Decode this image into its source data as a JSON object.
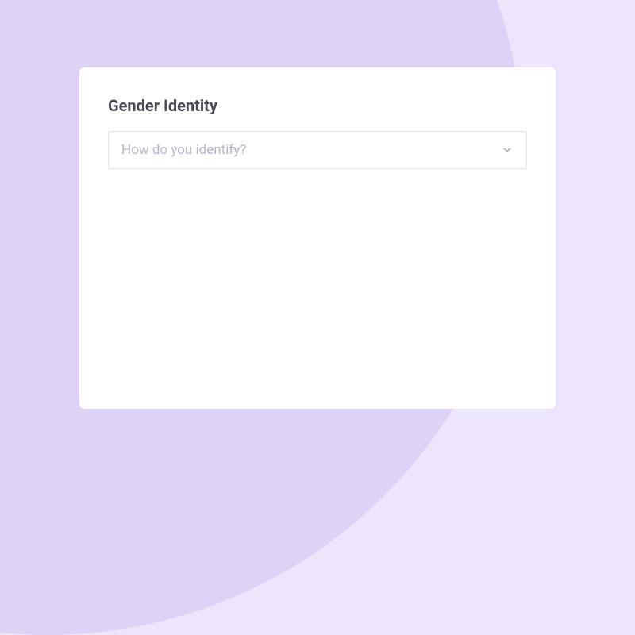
{
  "card": {
    "title": "Gender Identity",
    "select": {
      "placeholder": "How do you identify?"
    }
  }
}
